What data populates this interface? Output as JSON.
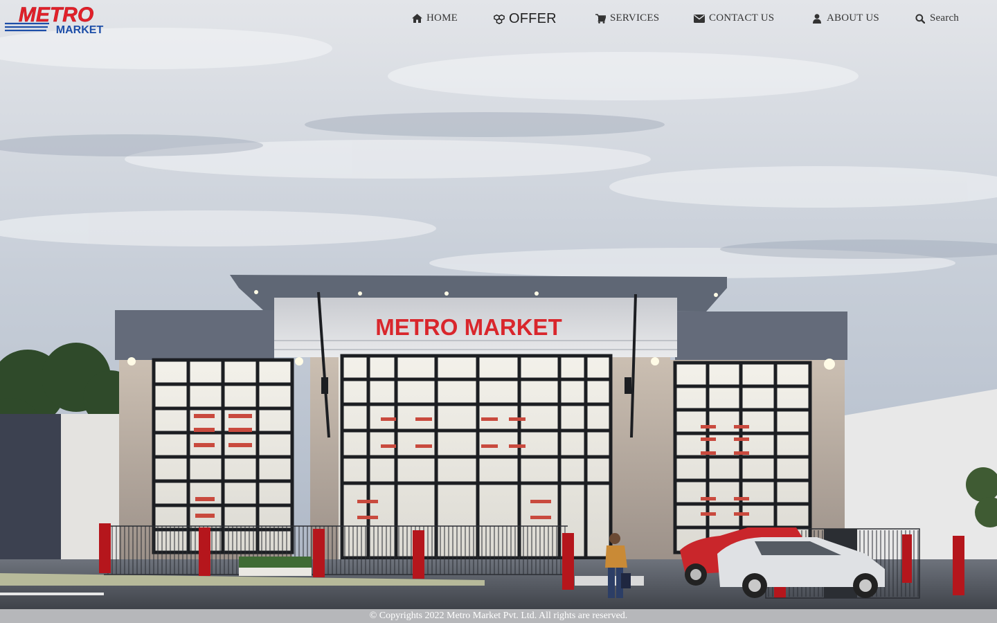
{
  "brand": {
    "line1": "METRO",
    "line2": "MARKET",
    "primary_color": "#e3202a",
    "secondary_color": "#1d4ea8"
  },
  "nav": {
    "items": [
      {
        "label": "HOME",
        "icon": "home-icon"
      },
      {
        "label": "OFFER",
        "icon": "cubes-icon"
      },
      {
        "label": "SERVICES",
        "icon": "cart-icon"
      },
      {
        "label": "CONTACT US",
        "icon": "envelope-icon"
      },
      {
        "label": "ABOUT US",
        "icon": "user-icon"
      },
      {
        "label": "Search",
        "icon": "search-icon"
      }
    ]
  },
  "hero": {
    "store_sign": "METRO MARKET",
    "sign_color": "#d9262c"
  },
  "footer": {
    "copyright": "© Copyrights 2022 Metro Market Pvt. Ltd. All rights are reserved."
  }
}
